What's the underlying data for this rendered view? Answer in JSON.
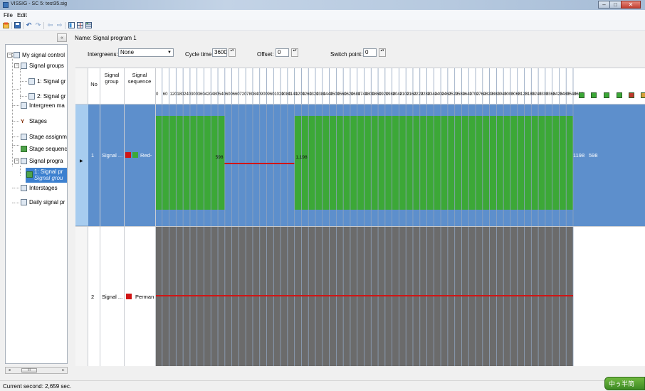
{
  "window": {
    "title": "VISSIG - SC 5: test35.sig",
    "minimize_label": "–",
    "maximize_label": "□",
    "close_label": "✕"
  },
  "menu": {
    "file": "File",
    "edit": "Edit"
  },
  "toolbar": {
    "icons": [
      "new-icon",
      "save-icon",
      "undo-icon",
      "redo-icon",
      "back-icon",
      "forward-icon",
      "view-grid-icon",
      "view-split-icon",
      "view-table-icon"
    ],
    "undo_glyph": "↶",
    "redo_glyph": "↷",
    "back_glyph": "⇦",
    "forward_glyph": "⇨"
  },
  "tree": {
    "collapse_glyph": "«",
    "items": [
      {
        "label": "My signal control"
      },
      {
        "label": "Signal groups"
      },
      {
        "label": "1: Signal gr"
      },
      {
        "label": "2: Signal gr"
      },
      {
        "label": "Intergreen ma"
      },
      {
        "label": "Stages"
      },
      {
        "label": "Stage assignm"
      },
      {
        "label": "Stage sequenc"
      },
      {
        "label": "Signal progra"
      },
      {
        "label": "Interstages"
      },
      {
        "label": "Daily signal pr"
      }
    ],
    "selected": {
      "line1": "1: Signal pr",
      "line2": "Signal grou"
    },
    "scroll_left": "◂",
    "scroll_right": "▸",
    "scroll_thumb": "III"
  },
  "program": {
    "name_label": "Name:",
    "name_value": "Signal program 1",
    "intergreens_label": "Intergreens:",
    "intergreens_value": "None",
    "cycle_time_label": "Cycle time:",
    "cycle_time_value": "3600",
    "offset_label": "Offset:",
    "offset_value": "0",
    "switch_point_label": "Switch point:",
    "switch_point_value": "0",
    "spin_glyph": "▴▾",
    "dropdown_glyph": "▼"
  },
  "table": {
    "col_no": "No",
    "col_group_l1": "Signal",
    "col_group_l2": "group",
    "col_seq_l1": "Signal",
    "col_seq_l2": "sequence",
    "row_marker": "▶",
    "rows": [
      {
        "no": "1",
        "group": "Signal ...",
        "sequence": "Red-",
        "seq_colors": [
          "#d11515",
          "#3ca837"
        ],
        "right_values": [
          "1198",
          "598"
        ]
      },
      {
        "no": "2",
        "group": "Signal ...",
        "sequence": "Perman",
        "seq_colors": [
          "#d11515"
        ],
        "right_values": []
      }
    ]
  },
  "timeline": {
    "tick_labels": [
      "0",
      "60",
      "120",
      "180",
      "240",
      "300",
      "360",
      "420",
      "480",
      "540",
      "600",
      "660",
      "720",
      "780",
      "840",
      "900",
      "960",
      "1020",
      "1080",
      "1140",
      "1200",
      "1260",
      "1320",
      "1380",
      "1440",
      "1500",
      "1560",
      "1620",
      "1680",
      "1740",
      "1800",
      "1860",
      "1920",
      "1980",
      "2040",
      "2100",
      "2160",
      "2220",
      "2280",
      "2340",
      "2400",
      "2460",
      "2520",
      "2580",
      "2640",
      "2700",
      "2760",
      "2820",
      "2880",
      "2940",
      "3000",
      "3060",
      "3120",
      "3180",
      "3240",
      "3300",
      "3360",
      "3420",
      "3480",
      "3540",
      "3600"
    ],
    "cycle": 3600,
    "row1_green": [
      [
        0,
        598
      ],
      [
        1198,
        3600
      ]
    ],
    "row1_red": [
      [
        598,
        1198
      ]
    ],
    "row1_labels": [
      {
        "t": 598,
        "text": "598"
      },
      {
        "t": 1198,
        "text": "1,198"
      }
    ],
    "row2_red": [
      [
        0,
        3600
      ]
    ],
    "header_icons": [
      {
        "name": "stage-green-icon",
        "color": "#3ca837"
      },
      {
        "name": "stage-green-icon",
        "color": "#3ca837"
      },
      {
        "name": "stage-green-icon",
        "color": "#3ca837"
      },
      {
        "name": "stage-red-green-icon",
        "color": "#3ca837"
      },
      {
        "name": "stage-mixed-icon",
        "color": "#c0392b"
      },
      {
        "name": "stage-edit-icon",
        "color": "#d9a13a"
      }
    ]
  },
  "status": {
    "current_second": "Current second: 2,659 sec.",
    "ime": "中ぅ半简"
  }
}
